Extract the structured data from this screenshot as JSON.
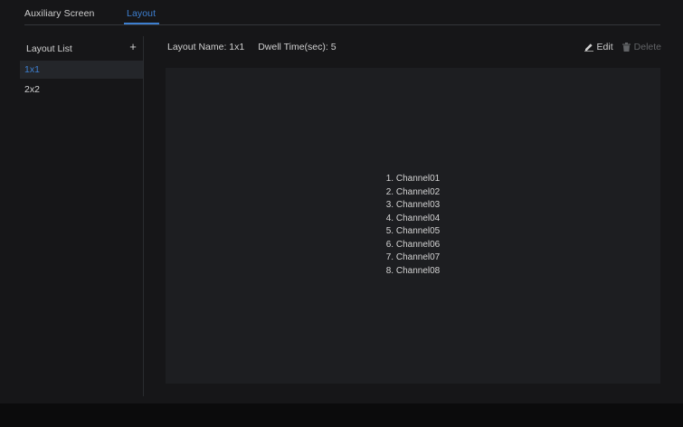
{
  "tabs": {
    "auxiliary_screen": "Auxiliary Screen",
    "layout": "Layout"
  },
  "sidebar": {
    "title": "Layout List",
    "add_label": "+",
    "items": [
      {
        "label": "1x1",
        "selected": true
      },
      {
        "label": "2x2",
        "selected": false
      }
    ]
  },
  "header": {
    "layout_name_label": "Layout Name: 1x1",
    "dwell_time_label": "Dwell Time(sec): 5"
  },
  "actions": {
    "edit_label": "Edit",
    "delete_label": "Delete"
  },
  "preview": {
    "channels": [
      "1. Channel01",
      "2. Channel02",
      "3. Channel03",
      "4. Channel04",
      "5. Channel05",
      "6. Channel06",
      "7. Channel07",
      "8. Channel08"
    ]
  },
  "colors": {
    "accent": "#3d7fd0",
    "background": "#161618",
    "panel": "#1d1e21",
    "text": "#d0d0d0",
    "disabled": "#616366"
  },
  "icons": {
    "add": "plus-icon",
    "edit": "pencil-icon",
    "delete": "trash-icon"
  }
}
